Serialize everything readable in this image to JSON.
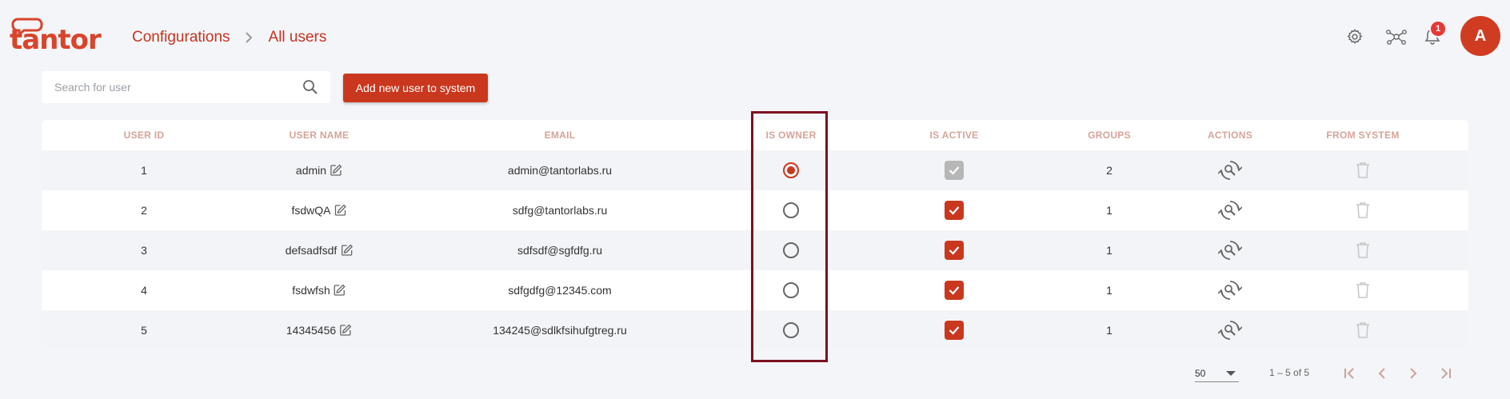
{
  "brand": {
    "logo_text": "tantor",
    "accent": "#c9381e"
  },
  "breadcrumb": {
    "items": [
      "Configurations",
      "All users"
    ]
  },
  "header": {
    "icons": [
      "gear-icon",
      "network-icon",
      "bell-icon"
    ],
    "notification_count": "1",
    "avatar_letter": "A"
  },
  "toolbar": {
    "search_placeholder": "Search for user",
    "search_value": "",
    "add_label": "Add new user to system"
  },
  "table": {
    "headers": {
      "user_id": "USER ID",
      "user_name": "USER NAME",
      "email": "EMAIL",
      "is_owner": "IS OWNER",
      "is_active": "IS ACTIVE",
      "groups": "GROUPS",
      "actions": "ACTIONS",
      "from_system": "FROM SYSTEM"
    },
    "rows": [
      {
        "id": "1",
        "name": "admin",
        "email": "admin@tantorlabs.ru",
        "is_owner": true,
        "is_active": true,
        "active_disabled": true,
        "groups": "2"
      },
      {
        "id": "2",
        "name": "fsdwQA",
        "email": "sdfg@tantorlabs.ru",
        "is_owner": false,
        "is_active": true,
        "active_disabled": false,
        "groups": "1"
      },
      {
        "id": "3",
        "name": "defsadfsdf",
        "email": "sdfsdf@sgfdfg.ru",
        "is_owner": false,
        "is_active": true,
        "active_disabled": false,
        "groups": "1"
      },
      {
        "id": "4",
        "name": "fsdwfsh",
        "email": "sdfgdfg@12345.com",
        "is_owner": false,
        "is_active": true,
        "active_disabled": false,
        "groups": "1"
      },
      {
        "id": "5",
        "name": "14345456",
        "email": "134245@sdlkfsihufgtreg.ru",
        "is_owner": false,
        "is_active": true,
        "active_disabled": false,
        "groups": "1"
      }
    ]
  },
  "pagination": {
    "page_size": "50",
    "range": "1 – 5 of 5"
  }
}
